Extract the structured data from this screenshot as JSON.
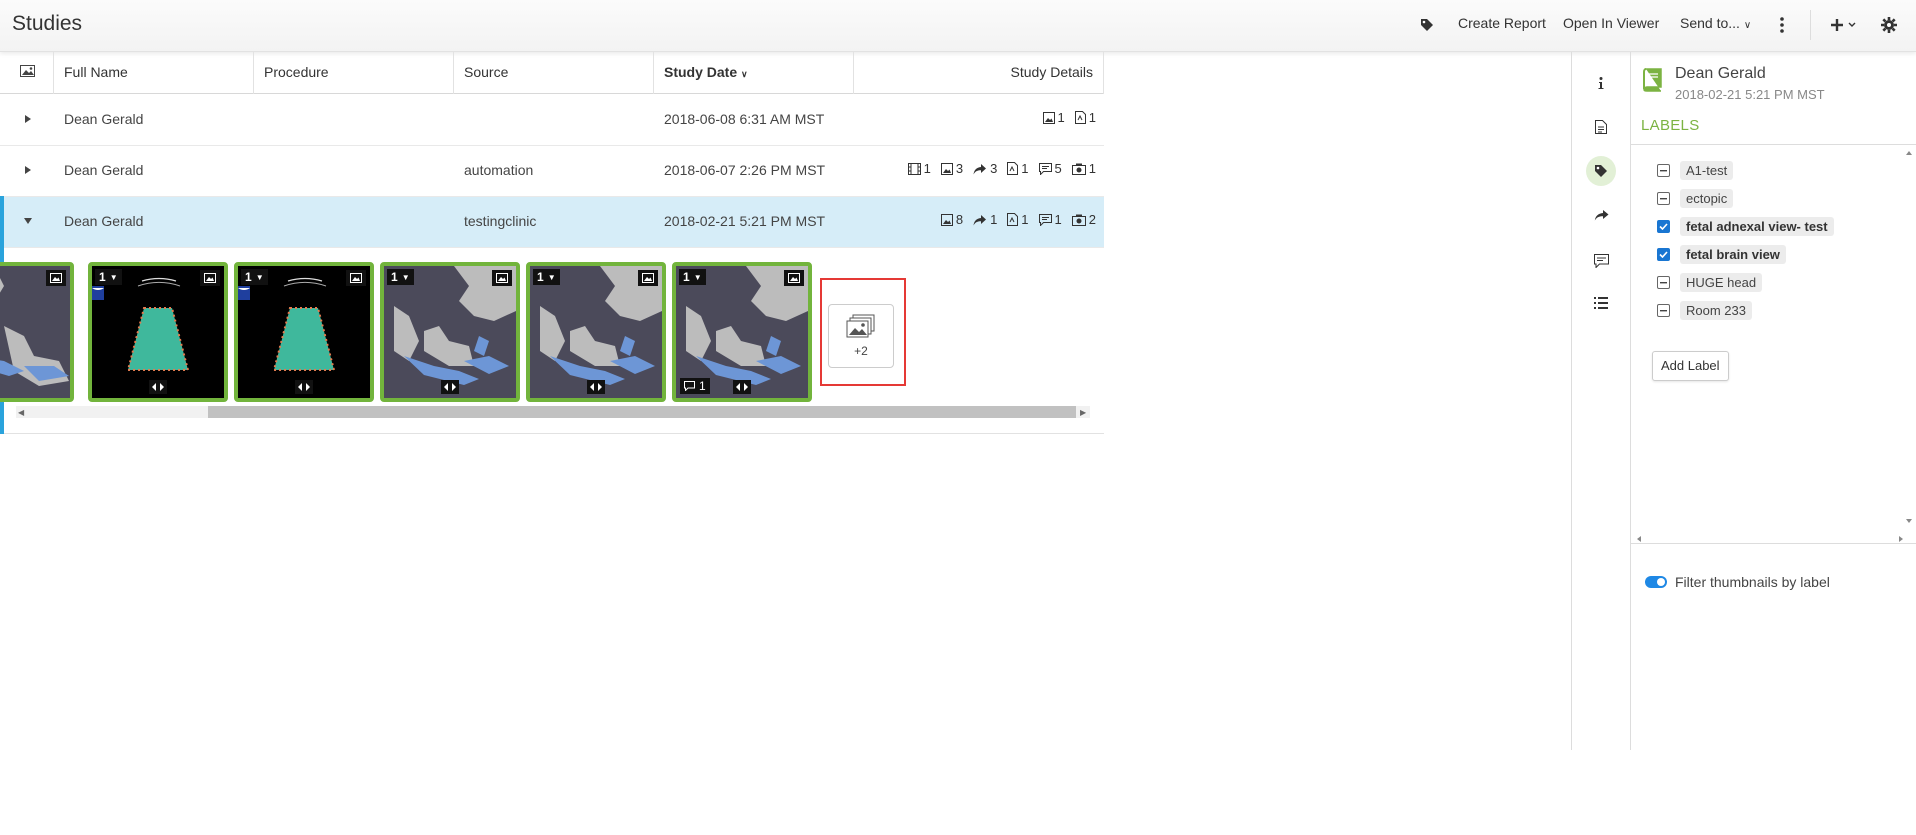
{
  "header": {
    "title": "Studies",
    "create_report": "Create Report",
    "open_in_viewer": "Open In Viewer",
    "send_to": "Send to..."
  },
  "table": {
    "columns": [
      "Full Name",
      "Procedure",
      "Source",
      "Study Date",
      "Study Details"
    ],
    "rows": [
      {
        "name": "Dean Gerald",
        "source": "",
        "date": "2018-06-08 6:31 AM MST",
        "details": [
          {
            "icon": "image-icon",
            "count": "1"
          },
          {
            "icon": "pdf-icon",
            "count": "1"
          }
        ]
      },
      {
        "name": "Dean Gerald",
        "source": "automation",
        "date": "2018-06-07 2:26 PM MST",
        "details": [
          {
            "icon": "film-icon",
            "count": "1"
          },
          {
            "icon": "image-icon",
            "count": "3"
          },
          {
            "icon": "share-icon",
            "count": "3"
          },
          {
            "icon": "pdf-icon",
            "count": "1"
          },
          {
            "icon": "comment-icon",
            "count": "5"
          },
          {
            "icon": "camera-icon",
            "count": "1"
          }
        ]
      },
      {
        "name": "Dean Gerald",
        "source": "testingclinic",
        "date": "2018-02-21 5:21 PM MST",
        "details": [
          {
            "icon": "image-icon",
            "count": "8"
          },
          {
            "icon": "share-icon",
            "count": "1"
          },
          {
            "icon": "pdf-icon",
            "count": "1"
          },
          {
            "icon": "comment-icon",
            "count": "1"
          },
          {
            "icon": "camera-icon",
            "count": "2"
          }
        ]
      }
    ]
  },
  "thumbnails": {
    "items": [
      {
        "type": "map",
        "badge": ""
      },
      {
        "type": "ultrasound",
        "badge": "1"
      },
      {
        "type": "ultrasound",
        "badge": "1"
      },
      {
        "type": "map",
        "badge": "1"
      },
      {
        "type": "map",
        "badge": "1"
      },
      {
        "type": "map",
        "badge": "1",
        "comments": "1"
      }
    ],
    "more_count": "+2"
  },
  "panel": {
    "study_name": "Dean Gerald",
    "study_date": "2018-02-21 5:21 PM MST",
    "labels_title": "LABELS",
    "labels": [
      {
        "text": "A1-test",
        "checked": false
      },
      {
        "text": "ectopic",
        "checked": false
      },
      {
        "text": "fetal adnexal view- test",
        "checked": true
      },
      {
        "text": "fetal brain view",
        "checked": true
      },
      {
        "text": "HUGE head",
        "checked": false
      },
      {
        "text": "Room 233",
        "checked": false
      }
    ],
    "add_label": "Add Label",
    "filter_label": "Filter thumbnails by label"
  },
  "colors": {
    "accent_green": "#72b43c",
    "selected_row": "#d6edf8",
    "selection_bar": "#2aa3dc",
    "highlight_red": "#e53935",
    "toggle_blue": "#1e88e5"
  }
}
